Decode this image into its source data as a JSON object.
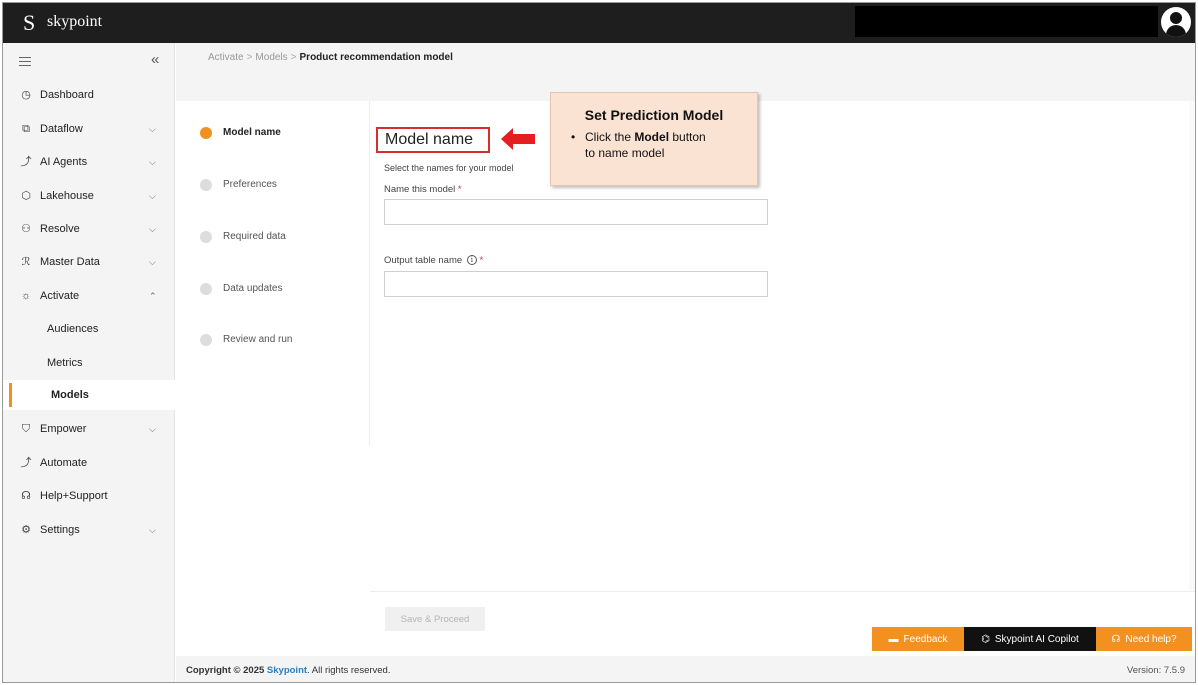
{
  "app": {
    "logo_letter": "S",
    "name": "skypoint"
  },
  "sidebar": {
    "collapse_glyph": "«",
    "items": [
      {
        "label": "Dashboard",
        "icon": "dashboard-icon",
        "glyph": "◷"
      },
      {
        "label": "Dataflow",
        "icon": "dataflow-icon",
        "glyph": "⧉"
      },
      {
        "label": "AI Agents",
        "icon": "ai-agents-icon",
        "glyph": "⤴"
      },
      {
        "label": "Lakehouse",
        "icon": "lakehouse-icon",
        "glyph": "⬡"
      },
      {
        "label": "Resolve",
        "icon": "resolve-icon",
        "glyph": "⚇"
      },
      {
        "label": "Master Data",
        "icon": "master-data-icon",
        "glyph": "ℛ"
      },
      {
        "label": "Activate",
        "icon": "bulb-icon",
        "glyph": "☼"
      },
      {
        "label": "Audiences"
      },
      {
        "label": "Metrics"
      },
      {
        "label": "Models"
      },
      {
        "label": "Empower",
        "icon": "shield-icon",
        "glyph": "⛉"
      },
      {
        "label": "Automate",
        "icon": "automate-icon",
        "glyph": "⤴"
      },
      {
        "label": "Help+Support",
        "icon": "headset-icon",
        "glyph": "☊"
      },
      {
        "label": "Settings",
        "icon": "gear-icon",
        "glyph": "⚙"
      }
    ],
    "chevron_down": "⌵",
    "chevron_up": "⌃"
  },
  "breadcrumb": {
    "items": [
      "Activate",
      "Models"
    ],
    "current": "Product recommendation model",
    "separator": ">"
  },
  "steps": [
    {
      "label": "Model name",
      "active": true
    },
    {
      "label": "Preferences"
    },
    {
      "label": "Required data"
    },
    {
      "label": "Data updates"
    },
    {
      "label": "Review and run"
    }
  ],
  "form": {
    "title": "Model name",
    "subtitle": "Select the names for your model",
    "name_label": "Name this model",
    "output_label": "Output table name",
    "required_mark": "*",
    "info_glyph": "i",
    "name_value": "",
    "output_value": ""
  },
  "callout": {
    "title": "Set Prediction Model",
    "bullet": "•",
    "line1_pre": "Click the ",
    "line1_bold": "Model",
    "line1_post": " button",
    "line2": "to name model"
  },
  "buttons": {
    "save": "Save & Proceed"
  },
  "help_bar": {
    "feedback": "Feedback",
    "copilot": "Skypoint AI Copilot",
    "help": "Need help?"
  },
  "footer": {
    "copyright_prefix": "Copyright © 2025 ",
    "brand": "Skypoint",
    "copyright_suffix": ". All rights reserved.",
    "version": "Version: 7.5.9"
  },
  "colors": {
    "accent": "#f39120",
    "highlight_red": "#d32f2f",
    "callout_bg": "#fbe3d3",
    "topbar": "#1e1e1e"
  }
}
